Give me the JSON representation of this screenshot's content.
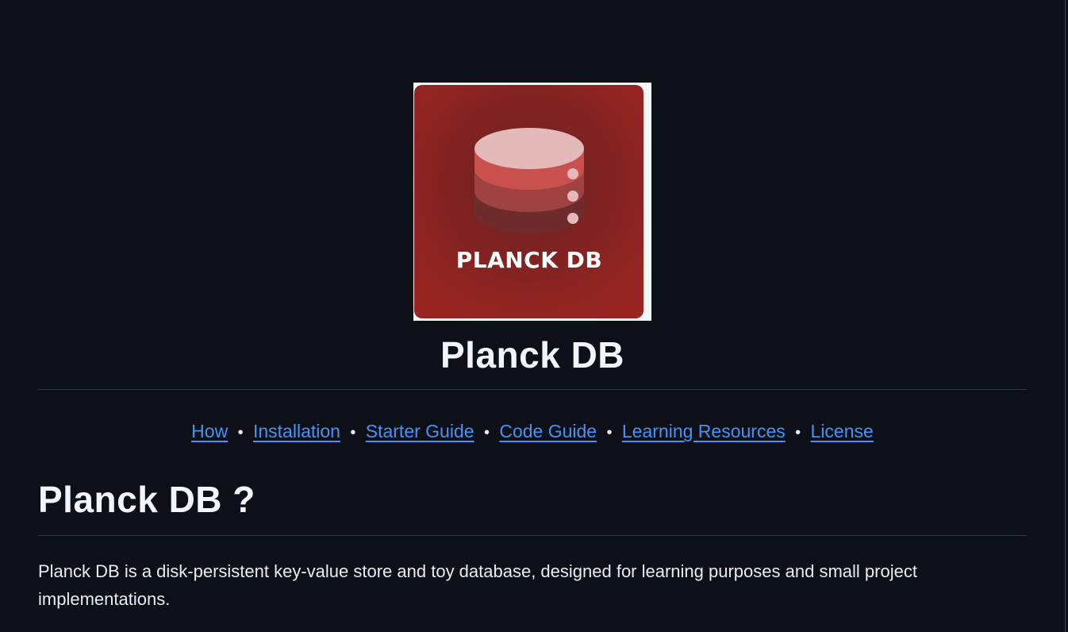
{
  "logo": {
    "text": "PLANCK DB",
    "colors": {
      "tile": "#8a2422",
      "disk_top": "#e3b9b9",
      "layer_1": "#c9504c",
      "layer_2": "#9e4341",
      "layer_3": "#6e2d2c",
      "dots": "#e3b9b9"
    }
  },
  "header": {
    "title": "Planck DB"
  },
  "nav": {
    "links": [
      "How",
      "Installation",
      "Starter Guide",
      "Code Guide",
      "Learning Resources",
      "License"
    ],
    "separator": "•",
    "link_color": "#4493f8"
  },
  "section": {
    "heading": "Planck DB ?",
    "paragraph": "Planck DB is a disk-persistent key-value store and toy database, designed for learning purposes and small project implementations."
  }
}
